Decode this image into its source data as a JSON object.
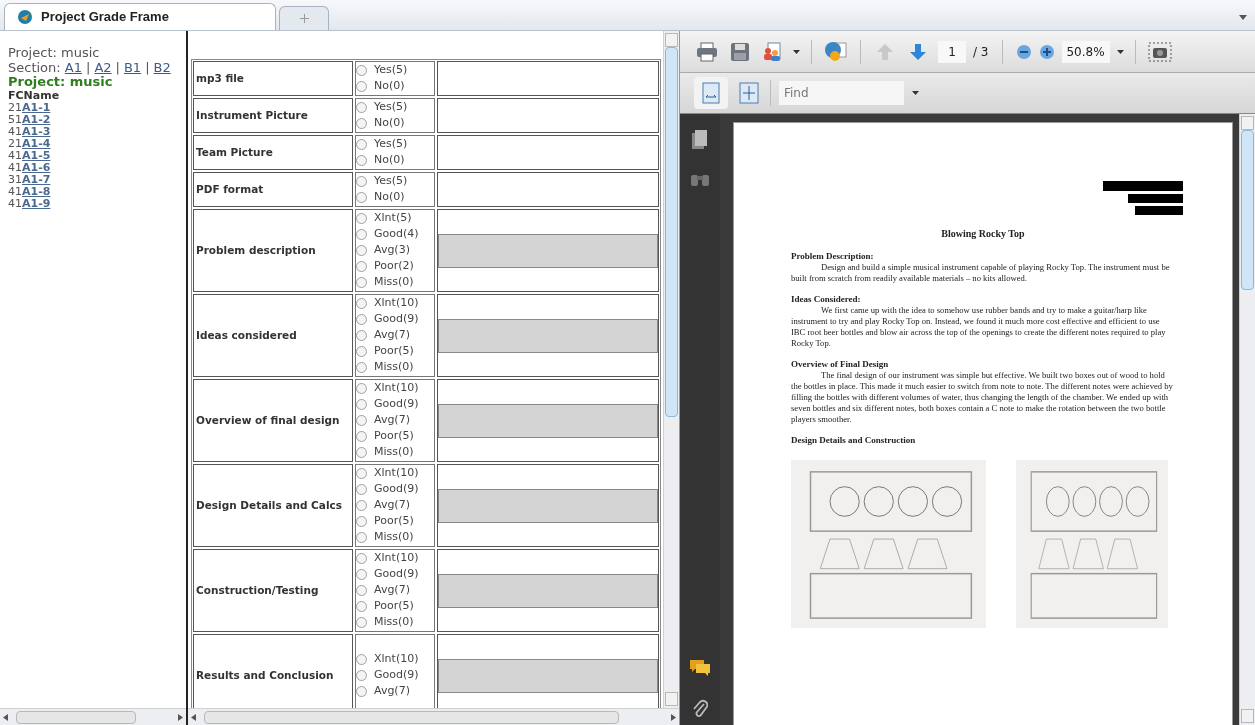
{
  "tabs": [
    {
      "label": "Project Grade Frame",
      "selected": true
    }
  ],
  "sidebar": {
    "project": "Project: music",
    "section_label": "Section:",
    "sections": [
      "A1",
      "A2",
      "B1",
      "B2"
    ],
    "separator": "|",
    "heading": "Project: music",
    "column": "FCName",
    "items": [
      {
        "prefix": "21",
        "link": "A1-1"
      },
      {
        "prefix": "51",
        "link": "A1-2"
      },
      {
        "prefix": "41",
        "link": "A1-3"
      },
      {
        "prefix": "21",
        "link": "A1-4"
      },
      {
        "prefix": "41",
        "link": "A1-5"
      },
      {
        "prefix": "41",
        "link": "A1-6"
      },
      {
        "prefix": "31",
        "link": "A1-7"
      },
      {
        "prefix": "41",
        "link": "A1-8"
      },
      {
        "prefix": "41",
        "link": "A1-9"
      }
    ]
  },
  "rubric": [
    {
      "kind": "yesno",
      "criterion": "mp3 file",
      "options": [
        {
          "label": "Yes(5)",
          "selected": false
        },
        {
          "label": "No(0)",
          "selected": false
        }
      ]
    },
    {
      "kind": "yesno",
      "criterion": "Instrument Picture",
      "options": [
        {
          "label": "Yes(5)",
          "selected": false
        },
        {
          "label": "No(0)",
          "selected": false
        }
      ]
    },
    {
      "kind": "yesno",
      "criterion": "Team Picture",
      "options": [
        {
          "label": "Yes(5)",
          "selected": false
        },
        {
          "label": "No(0)",
          "selected": false
        }
      ]
    },
    {
      "kind": "yesno",
      "criterion": "PDF format",
      "options": [
        {
          "label": "Yes(5)",
          "selected": false
        },
        {
          "label": "No(0)",
          "selected": false
        }
      ]
    },
    {
      "kind": "scale",
      "criterion": "Problem description",
      "options": [
        {
          "label": "Xlnt(5)",
          "selected": false
        },
        {
          "label": "Good(4)",
          "selected": false
        },
        {
          "label": "Avg(3)",
          "selected": false
        },
        {
          "label": "Poor(2)",
          "selected": false
        },
        {
          "label": "Miss(0)",
          "selected": false
        }
      ]
    },
    {
      "kind": "scale",
      "criterion": "Ideas considered",
      "options": [
        {
          "label": "Xlnt(10)",
          "selected": false
        },
        {
          "label": "Good(9)",
          "selected": false
        },
        {
          "label": "Avg(7)",
          "selected": false
        },
        {
          "label": "Poor(5)",
          "selected": false
        },
        {
          "label": "Miss(0)",
          "selected": false
        }
      ]
    },
    {
      "kind": "scale",
      "criterion": "Overview of final design",
      "options": [
        {
          "label": "Xlnt(10)",
          "selected": false
        },
        {
          "label": "Good(9)",
          "selected": false
        },
        {
          "label": "Avg(7)",
          "selected": false
        },
        {
          "label": "Poor(5)",
          "selected": false
        },
        {
          "label": "Miss(0)",
          "selected": false
        }
      ]
    },
    {
      "kind": "scale",
      "criterion": "Design Details and Calcs",
      "options": [
        {
          "label": "Xlnt(10)",
          "selected": false
        },
        {
          "label": "Good(9)",
          "selected": false
        },
        {
          "label": "Avg(7)",
          "selected": false
        },
        {
          "label": "Poor(5)",
          "selected": false
        },
        {
          "label": "Miss(0)",
          "selected": false
        }
      ]
    },
    {
      "kind": "scale",
      "criterion": "Construction/Testing",
      "options": [
        {
          "label": "Xlnt(10)",
          "selected": false
        },
        {
          "label": "Good(9)",
          "selected": false
        },
        {
          "label": "Avg(7)",
          "selected": false
        },
        {
          "label": "Poor(5)",
          "selected": false
        },
        {
          "label": "Miss(0)",
          "selected": false
        }
      ]
    },
    {
      "kind": "scale",
      "criterion": "Results and Conclusion",
      "options": [
        {
          "label": "Xlnt(10)",
          "selected": false
        },
        {
          "label": "Good(9)",
          "selected": false
        },
        {
          "label": "Avg(7)",
          "selected": false
        }
      ]
    }
  ],
  "pdf_toolbar": {
    "page": "1",
    "page_count": "/ 3",
    "zoom": "50.8%",
    "find_placeholder": "Find"
  },
  "document": {
    "title": "Blowing Rocky Top",
    "sections": [
      {
        "heading": "Problem Description:",
        "body": "Design and build a simple musical instrument capable of playing Rocky Top. The instrument must be built from scratch from readily available materials – no kits allowed."
      },
      {
        "heading": "Ideas Considered:",
        "body": "We first came up with the idea to somehow use rubber bands and try to make a guitar/harp like instrument to try and play Rocky Top on.  Instead, we found it much more cost effective and efficient to use IBC root beer bottles and blow air across the top of the openings to create the different notes required to play Rocky Top."
      },
      {
        "heading": "Overview of Final Design",
        "body": "The final design of our instrument was simple but effective. We built two boxes out of wood to hold the bottles in place. This made it much easier to switch from note to note. The different notes were achieved by filling the bottles with different volumes of water, thus changing the length of the chamber. We ended up with seven bottles and six different notes, both boxes contain a C note to make the rotation between the two bottle players smoother."
      },
      {
        "heading": "Design Details and Construction"
      }
    ]
  }
}
